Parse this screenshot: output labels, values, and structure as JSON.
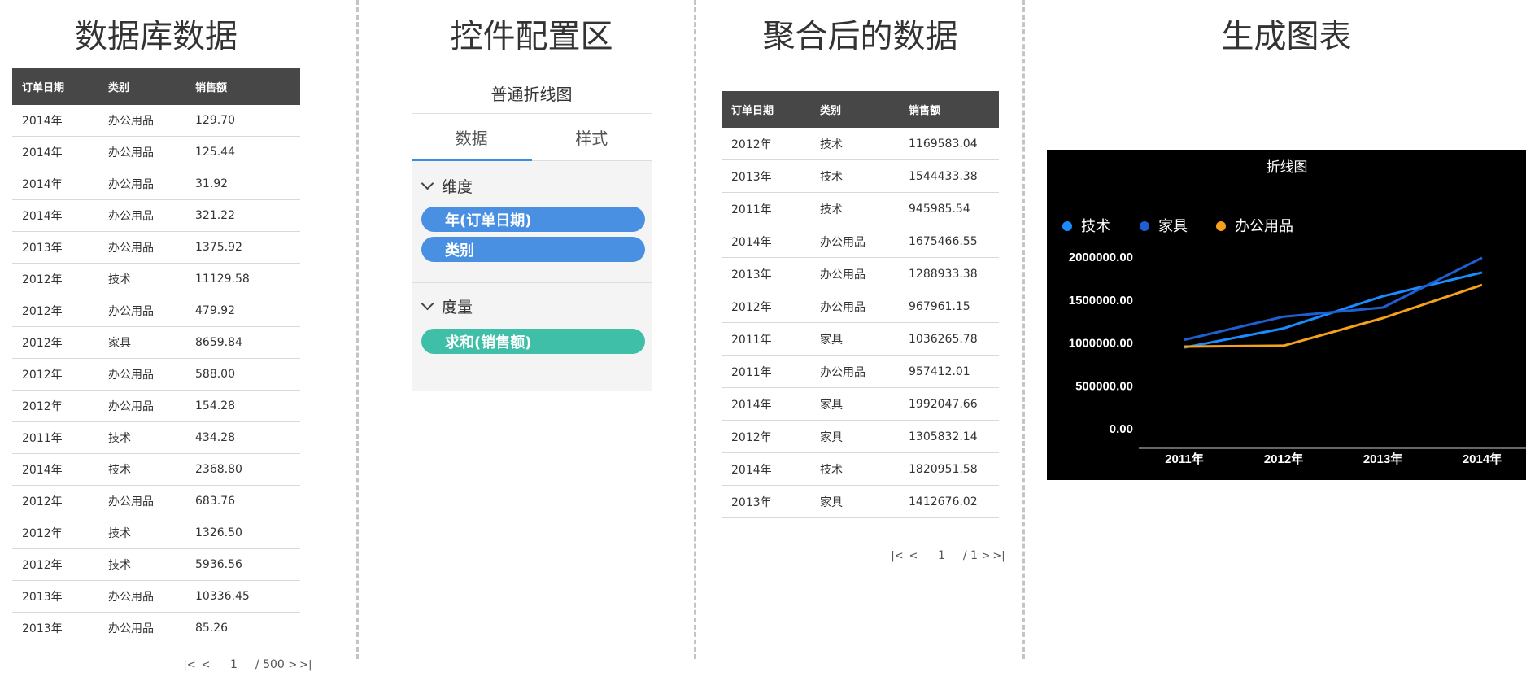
{
  "sections": {
    "database_title": "数据库数据",
    "config_title": "控件配置区",
    "aggregated_title": "聚合后的数据",
    "chart_title": "生成图表"
  },
  "db_table": {
    "columns": [
      "订单日期",
      "类别",
      "销售额"
    ],
    "rows": [
      [
        "2014年",
        "办公用品",
        "129.70"
      ],
      [
        "2014年",
        "办公用品",
        "125.44"
      ],
      [
        "2014年",
        "办公用品",
        "31.92"
      ],
      [
        "2014年",
        "办公用品",
        "321.22"
      ],
      [
        "2013年",
        "办公用品",
        "1375.92"
      ],
      [
        "2012年",
        "技术",
        "11129.58"
      ],
      [
        "2012年",
        "办公用品",
        "479.92"
      ],
      [
        "2012年",
        "家具",
        "8659.84"
      ],
      [
        "2012年",
        "办公用品",
        "588.00"
      ],
      [
        "2012年",
        "办公用品",
        "154.28"
      ],
      [
        "2011年",
        "技术",
        "434.28"
      ],
      [
        "2014年",
        "技术",
        "2368.80"
      ],
      [
        "2012年",
        "办公用品",
        "683.76"
      ],
      [
        "2012年",
        "技术",
        "1326.50"
      ],
      [
        "2012年",
        "技术",
        "5936.56"
      ],
      [
        "2013年",
        "办公用品",
        "10336.45"
      ],
      [
        "2013年",
        "办公用品",
        "85.26"
      ]
    ],
    "pager": {
      "current": "1",
      "total": "/ 500"
    }
  },
  "config": {
    "chart_type": "普通折线图",
    "tabs": [
      "数据",
      "样式"
    ],
    "dimension_title": "维度",
    "dimensions": [
      "年(订单日期)",
      "类别"
    ],
    "measure_title": "度量",
    "measures": [
      "求和(销售额)"
    ]
  },
  "agg_table": {
    "columns": [
      "订单日期",
      "类别",
      "销售额"
    ],
    "rows": [
      [
        "2012年",
        "技术",
        "1169583.04"
      ],
      [
        "2013年",
        "技术",
        "1544433.38"
      ],
      [
        "2011年",
        "技术",
        "945985.54"
      ],
      [
        "2014年",
        "办公用品",
        "1675466.55"
      ],
      [
        "2013年",
        "办公用品",
        "1288933.38"
      ],
      [
        "2012年",
        "办公用品",
        "967961.15"
      ],
      [
        "2011年",
        "家具",
        "1036265.78"
      ],
      [
        "2011年",
        "办公用品",
        "957412.01"
      ],
      [
        "2014年",
        "家具",
        "1992047.66"
      ],
      [
        "2012年",
        "家具",
        "1305832.14"
      ],
      [
        "2014年",
        "技术",
        "1820951.58"
      ],
      [
        "2013年",
        "家具",
        "1412676.02"
      ]
    ],
    "pager": {
      "current": "1",
      "total": "/ 1"
    }
  },
  "chart_data": {
    "type": "line",
    "title": "折线图",
    "categories": [
      "2011年",
      "2012年",
      "2013年",
      "2014年"
    ],
    "yticks": [
      "0.00",
      "500000.00",
      "1000000.00",
      "1500000.00",
      "2000000.00"
    ],
    "ylim": [
      0,
      2000000
    ],
    "grid": false,
    "legend_position": "top-left",
    "background": "#000000",
    "series": [
      {
        "name": "技术",
        "color": "#1a8cff",
        "values": [
          945985.54,
          1169583.04,
          1544433.38,
          1820951.58
        ]
      },
      {
        "name": "家具",
        "color": "#1f5fd1",
        "values": [
          1036265.78,
          1305832.14,
          1412676.02,
          1992047.66
        ]
      },
      {
        "name": "办公用品",
        "color": "#f5a11c",
        "values": [
          957412.01,
          967961.15,
          1288933.38,
          1675466.55
        ]
      }
    ]
  }
}
